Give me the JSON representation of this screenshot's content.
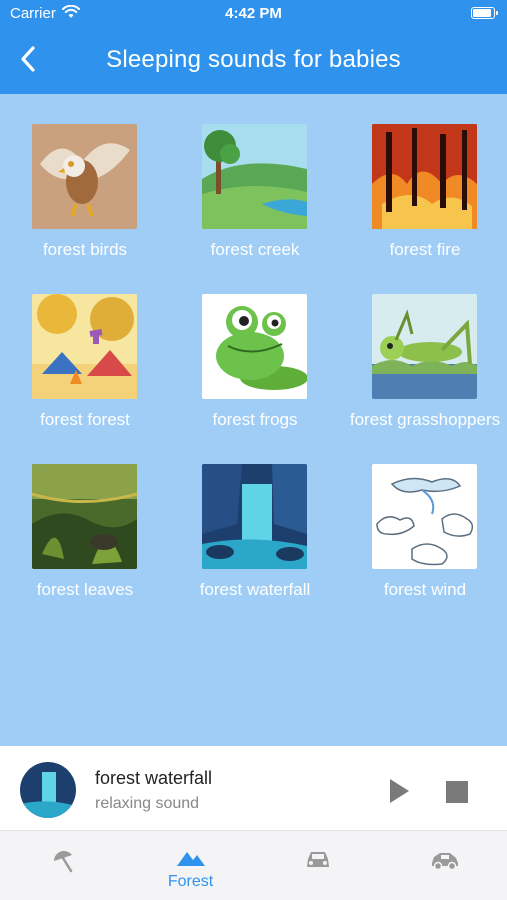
{
  "status_bar": {
    "carrier": "Carrier",
    "time": "4:42 PM"
  },
  "header": {
    "title": "Sleeping sounds for babies",
    "back_icon": "chevron-left-icon"
  },
  "grid": {
    "items": [
      {
        "label": "forest birds",
        "image": "bird-illustration"
      },
      {
        "label": "forest creek",
        "image": "creek-landscape-illustration"
      },
      {
        "label": "forest fire",
        "image": "fire-illustration"
      },
      {
        "label": "forest forest",
        "image": "camping-tent-illustration"
      },
      {
        "label": "forest frogs",
        "image": "frog-illustration"
      },
      {
        "label": "forest grasshoppers",
        "image": "grasshopper-illustration"
      },
      {
        "label": "forest leaves",
        "image": "leaves-illustration"
      },
      {
        "label": "forest waterfall",
        "image": "waterfall-illustration"
      },
      {
        "label": "forest wind",
        "image": "wind-clouds-illustration"
      }
    ]
  },
  "player": {
    "title": "forest waterfall",
    "subtitle": "relaxing sound",
    "play_icon": "play-icon",
    "stop_icon": "stop-icon"
  },
  "tabs": [
    {
      "label": "",
      "icon": "beach-umbrella-icon",
      "active": false
    },
    {
      "label": "Forest",
      "icon": "mountain-icon",
      "active": true
    },
    {
      "label": "",
      "icon": "car-icon",
      "active": false
    },
    {
      "label": "",
      "icon": "car-side-icon",
      "active": false
    }
  ],
  "colors": {
    "accent": "#2f93ee",
    "background": "#9fcdf6",
    "inactive_icon": "#9a9a9a"
  }
}
